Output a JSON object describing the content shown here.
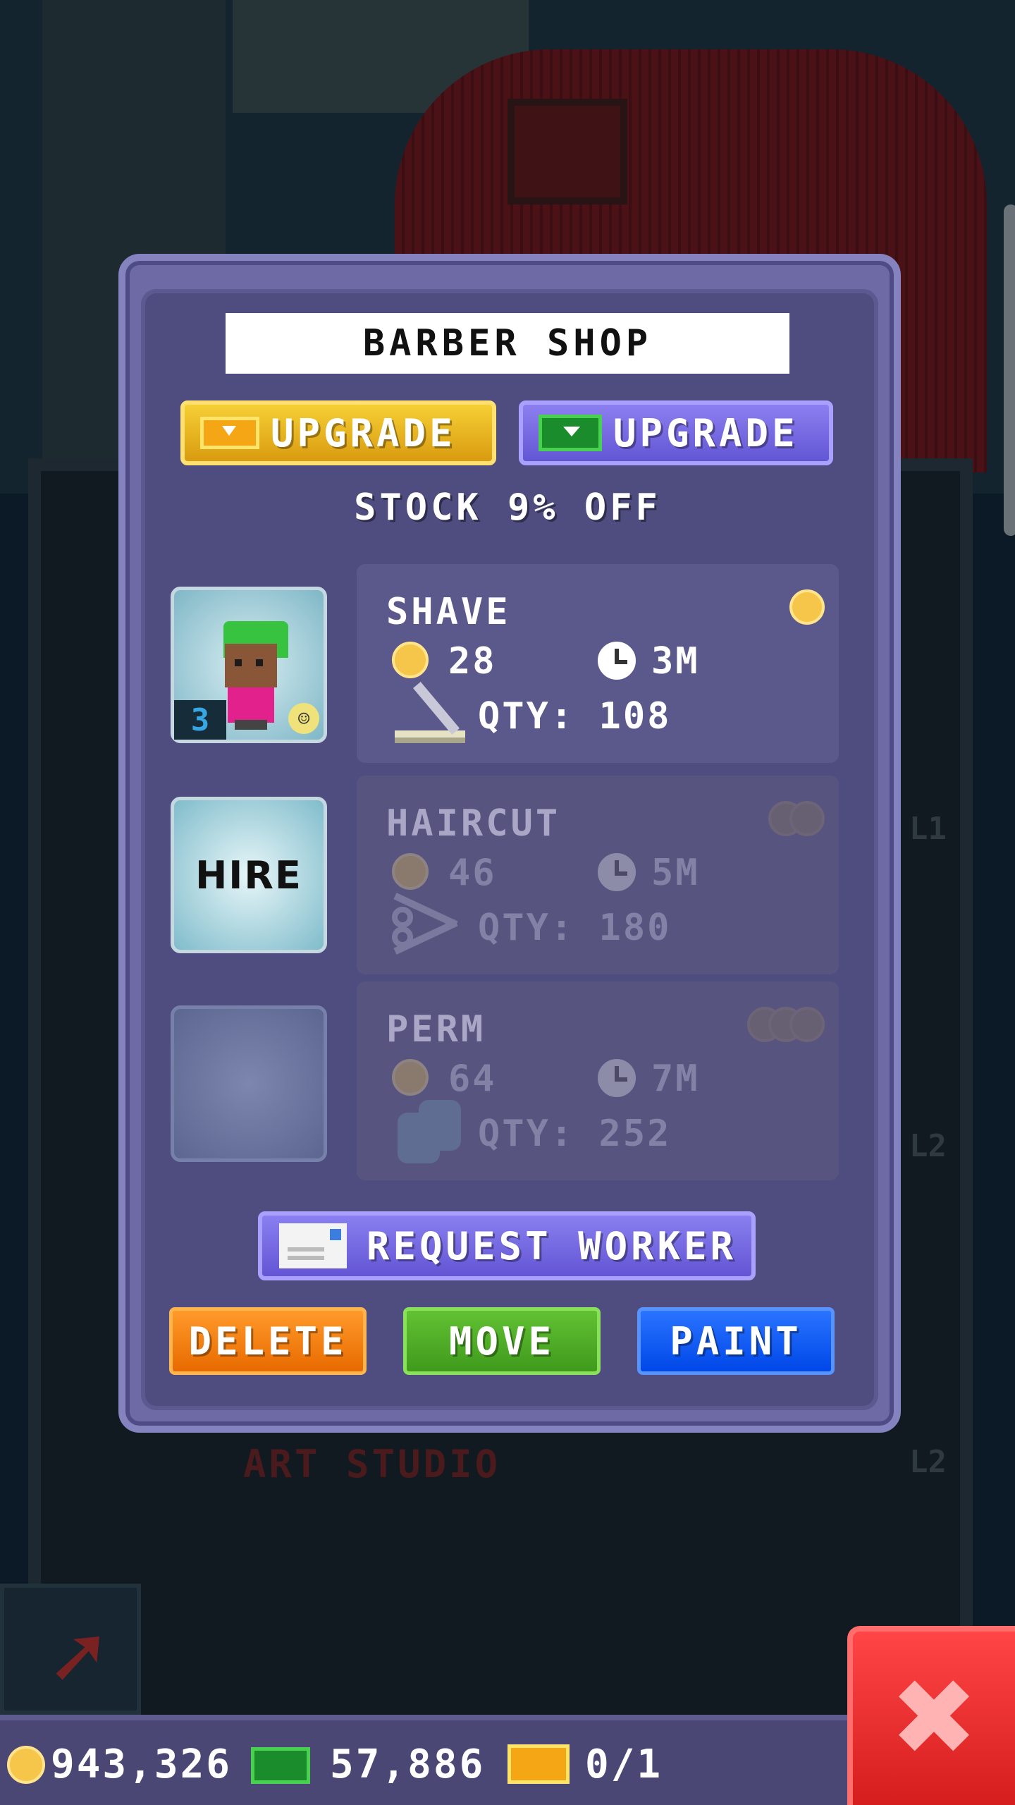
{
  "dialog": {
    "title": "BARBER SHOP",
    "upgrade_coins_label": "UPGRADE",
    "upgrade_bux_label": "UPGRADE",
    "stock_text": "STOCK 9% OFF",
    "request_worker_label": "REQUEST WORKER",
    "delete_label": "DELETE",
    "move_label": "MOVE",
    "paint_label": "PAINT"
  },
  "workers": {
    "slot1_level": "3",
    "hire_label": "HIRE"
  },
  "products": [
    {
      "name": "SHAVE",
      "price": "28",
      "time": "3M",
      "qty": "QTY: 108",
      "enabled": true
    },
    {
      "name": "HAIRCUT",
      "price": "46",
      "time": "5M",
      "qty": "QTY: 180",
      "enabled": false
    },
    {
      "name": "PERM",
      "price": "64",
      "time": "7M",
      "qty": "QTY: 252",
      "enabled": false
    }
  ],
  "status_bar": {
    "coins": "943,326",
    "bux": "57,886",
    "tickets": "0/1"
  },
  "background": {
    "floor_label": "ART STUDIO",
    "level_tags": [
      "L1",
      "L2",
      "L2"
    ]
  },
  "colors": {
    "dialog_bg": "#6d6aa6",
    "coin_gold": "#f6c64a",
    "delete_orange": "#e86a00",
    "move_green": "#3f9a1c",
    "paint_blue": "#0047e8",
    "close_red": "#d61d1d"
  },
  "icons": {
    "close": "close-x-icon",
    "coin": "coin-icon",
    "bux": "bux-cash-icon",
    "ticket": "golden-ticket-icon",
    "clock": "clock-icon"
  }
}
